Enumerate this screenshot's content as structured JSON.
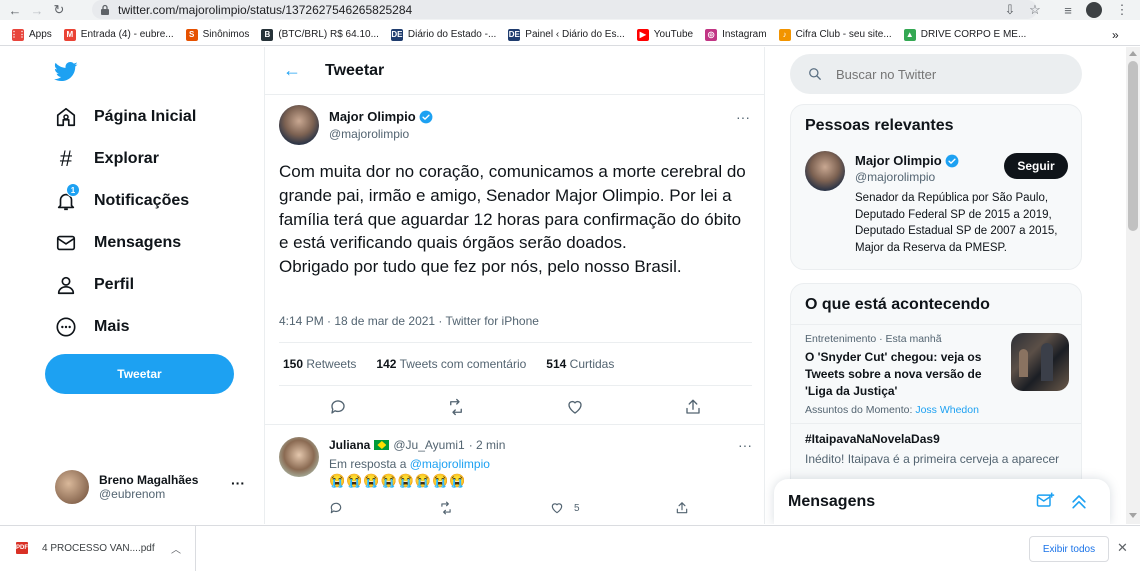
{
  "browser": {
    "url": "twitter.com/majorolimpio/status/1372627546265825284",
    "bookmarks": [
      {
        "label": "Apps",
        "color": "#e8453c",
        "glyph": "⋮⋮"
      },
      {
        "label": "Entrada (4) - eubre...",
        "color": "#ea4335",
        "glyph": "M"
      },
      {
        "label": "Sinônimos",
        "color": "#e65100",
        "glyph": "S"
      },
      {
        "label": "(BTC/BRL) R$ 64.10...",
        "color": "#263238",
        "glyph": "B"
      },
      {
        "label": "Diário do Estado -...",
        "color": "#1f3c6e",
        "glyph": "DE"
      },
      {
        "label": "Painel ‹ Diário do Es...",
        "color": "#1f3c6e",
        "glyph": "DE"
      },
      {
        "label": "YouTube",
        "color": "#ff0000",
        "glyph": "▶"
      },
      {
        "label": "Instagram",
        "color": "#c13584",
        "glyph": "◎"
      },
      {
        "label": "Cifra Club - seu site...",
        "color": "#f29400",
        "glyph": "♪"
      },
      {
        "label": "DRIVE CORPO E ME...",
        "color": "#34a853",
        "glyph": "▲"
      }
    ],
    "more_bookmarks": "»"
  },
  "sidebar": {
    "items": [
      {
        "label": "Página Inicial",
        "icon": "home-icon"
      },
      {
        "label": "Explorar",
        "icon": "hashtag-icon"
      },
      {
        "label": "Notificações",
        "icon": "bell-icon",
        "badge": "1"
      },
      {
        "label": "Mensagens",
        "icon": "mail-icon"
      },
      {
        "label": "Perfil",
        "icon": "user-icon"
      },
      {
        "label": "Mais",
        "icon": "more-circle-icon"
      }
    ],
    "tweet_button": "Tweetar",
    "account": {
      "name": "Breno Magalhães",
      "handle": "@eubrenom",
      "more": "···"
    }
  },
  "main": {
    "header_title": "Tweetar",
    "tweet": {
      "author_name": "Major Olimpio",
      "author_handle": "@majorolimpio",
      "text": "Com muita dor no coração, comunicamos a morte cerebral do grande pai, irmão e amigo, Senador Major Olimpio. Por lei a família terá que aguardar 12 horas para confirmação do óbito e está verificando quais órgãos serão doados.\nObrigado por tudo que fez por nós, pelo nosso Brasil.",
      "meta": "4:14 PM · 18 de mar de 2021 · Twitter for iPhone",
      "retweets_count": "150",
      "retweets_label": "Retweets",
      "comments_count": "142",
      "comments_label": "Tweets com comentário",
      "likes_count": "514",
      "likes_label": "Curtidas"
    },
    "reply": {
      "name": "Juliana",
      "handle": "@Ju_Ayumi1",
      "time": "· 2 min",
      "reply_to_prefix": "Em resposta a",
      "reply_to_handle": "@majorolimpio",
      "emoji": "😭😭😭😭😭😭😭😭",
      "like_count": "5"
    }
  },
  "right": {
    "search_placeholder": "Buscar no Twitter",
    "relevant_title": "Pessoas relevantes",
    "person": {
      "name": "Major Olimpio",
      "handle": "@majorolimpio",
      "bio": "Senador da República por São Paulo, Deputado Federal SP de 2015 a 2019, Deputado Estadual SP de 2007 a 2015, Major da Reserva da PMESP.",
      "follow_label": "Seguir"
    },
    "happening_title": "O que está acontecendo",
    "trend1": {
      "category": "Entretenimento · Esta manhã",
      "title": "O 'Snyder Cut' chegou: veja os Tweets sobre a nova versão de 'Liga da Justiça'",
      "sub_prefix": "Assuntos do Momento:",
      "sub_link": "Joss Whedon"
    },
    "trend2": {
      "title": "#ItaipavaNaNovelaDas9",
      "sub": "Inédito! Itaipava é a primeira cerveja a aparecer"
    },
    "messages_title": "Mensagens"
  },
  "downloads": {
    "file_name": "4 PROCESSO VAN....pdf",
    "file_type": "PDF",
    "show_all": "Exibir todos"
  }
}
